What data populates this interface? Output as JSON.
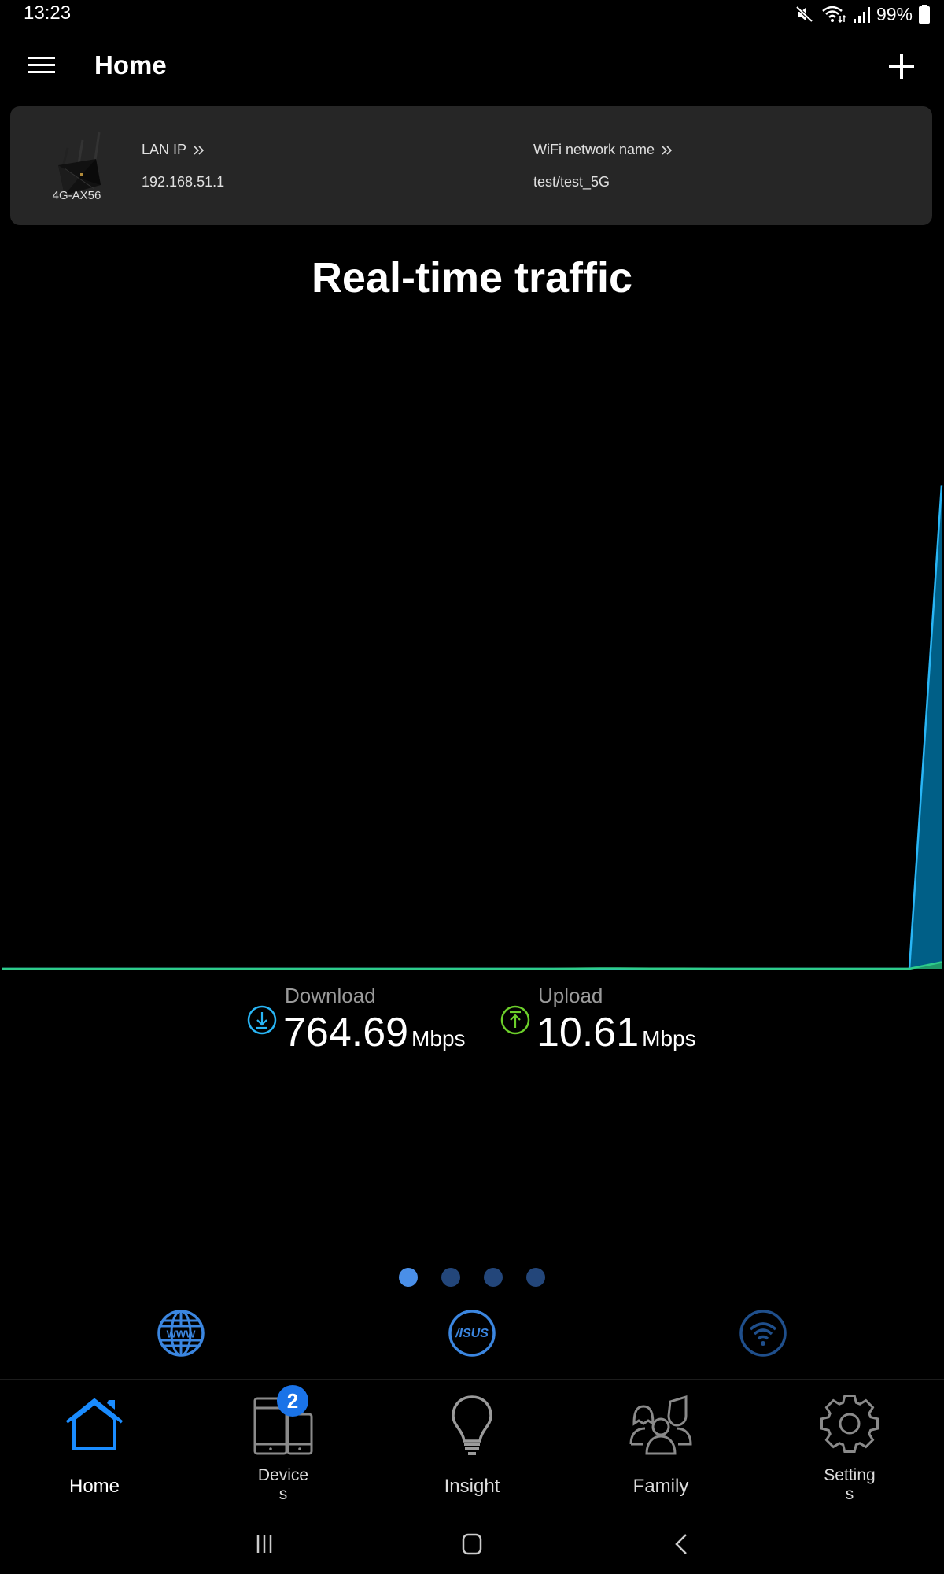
{
  "status_bar": {
    "time": "13:23",
    "icons": [
      "mute-icon",
      "wifi-icon",
      "signal-icon"
    ],
    "battery": "99%"
  },
  "app_bar": {
    "title": "Home",
    "menu_icon": "hamburger-menu-icon",
    "add_icon": "plus-icon"
  },
  "router_card": {
    "model": "4G-AX56",
    "lan_ip_label": "LAN IP",
    "lan_ip_value": "192.168.51.1",
    "wifi_label": "WiFi network name",
    "wifi_value": "test/test_5G"
  },
  "traffic": {
    "title": "Real-time traffic",
    "download_label": "Download",
    "download_value": "764.69",
    "download_unit": "Mbps",
    "upload_label": "Upload",
    "upload_value": "10.61",
    "upload_unit": "Mbps",
    "colors": {
      "download_line": "#29b6f6",
      "download_fill": "#005f87",
      "upload_line": "#2ecc8a",
      "upload_fill": "#1f9a6a"
    }
  },
  "chart_data": {
    "type": "area",
    "title": "Real-time traffic",
    "xlabel": "",
    "ylabel": "",
    "x": [
      0,
      1,
      2,
      3,
      4,
      5,
      6,
      7,
      8,
      9,
      10,
      11,
      12,
      13,
      14,
      15,
      16,
      17,
      18,
      19,
      20,
      21,
      22,
      23,
      24,
      25,
      26,
      27,
      28,
      29
    ],
    "series": [
      {
        "name": "Download (Mbps)",
        "values": [
          0,
          0,
          0,
          0,
          0,
          0,
          0,
          0,
          0,
          0,
          0,
          0,
          0,
          0,
          0,
          0,
          0,
          0,
          0,
          0,
          0,
          0,
          0,
          0,
          0,
          0,
          0,
          0,
          0,
          764.69
        ]
      },
      {
        "name": "Upload (Mbps)",
        "values": [
          0,
          0,
          0,
          0,
          0,
          0,
          0,
          0,
          0,
          0,
          0,
          0,
          0,
          0,
          0,
          0,
          0,
          0,
          0.5,
          0.6,
          0.4,
          0.2,
          0,
          0,
          0,
          0,
          0,
          0,
          0,
          10.61
        ]
      }
    ],
    "ylim": [
      0,
      800
    ],
    "grid": false,
    "legend": "none"
  },
  "pager": {
    "count": 4,
    "active": 0,
    "active_color": "#4a8fe8",
    "inactive_color": "#23467a"
  },
  "quick_links": [
    {
      "name": "www-globe-icon"
    },
    {
      "name": "asus-logo-icon",
      "text": "/ISUS"
    },
    {
      "name": "wifi-circle-icon"
    }
  ],
  "bottom_nav": {
    "items": [
      {
        "label": "Home",
        "icon": "home-icon",
        "active": true
      },
      {
        "label": "Device\ns",
        "icon": "devices-icon",
        "badge": "2"
      },
      {
        "label": "Insight",
        "icon": "lightbulb-icon"
      },
      {
        "label": "Family",
        "icon": "family-icon"
      },
      {
        "label": "Setting\ns",
        "icon": "gear-icon"
      }
    ],
    "active_color": "#1a8cff",
    "inactive_color": "#8a8a8a"
  },
  "system_nav": [
    "recents-icon",
    "home-circle-icon",
    "back-icon"
  ]
}
